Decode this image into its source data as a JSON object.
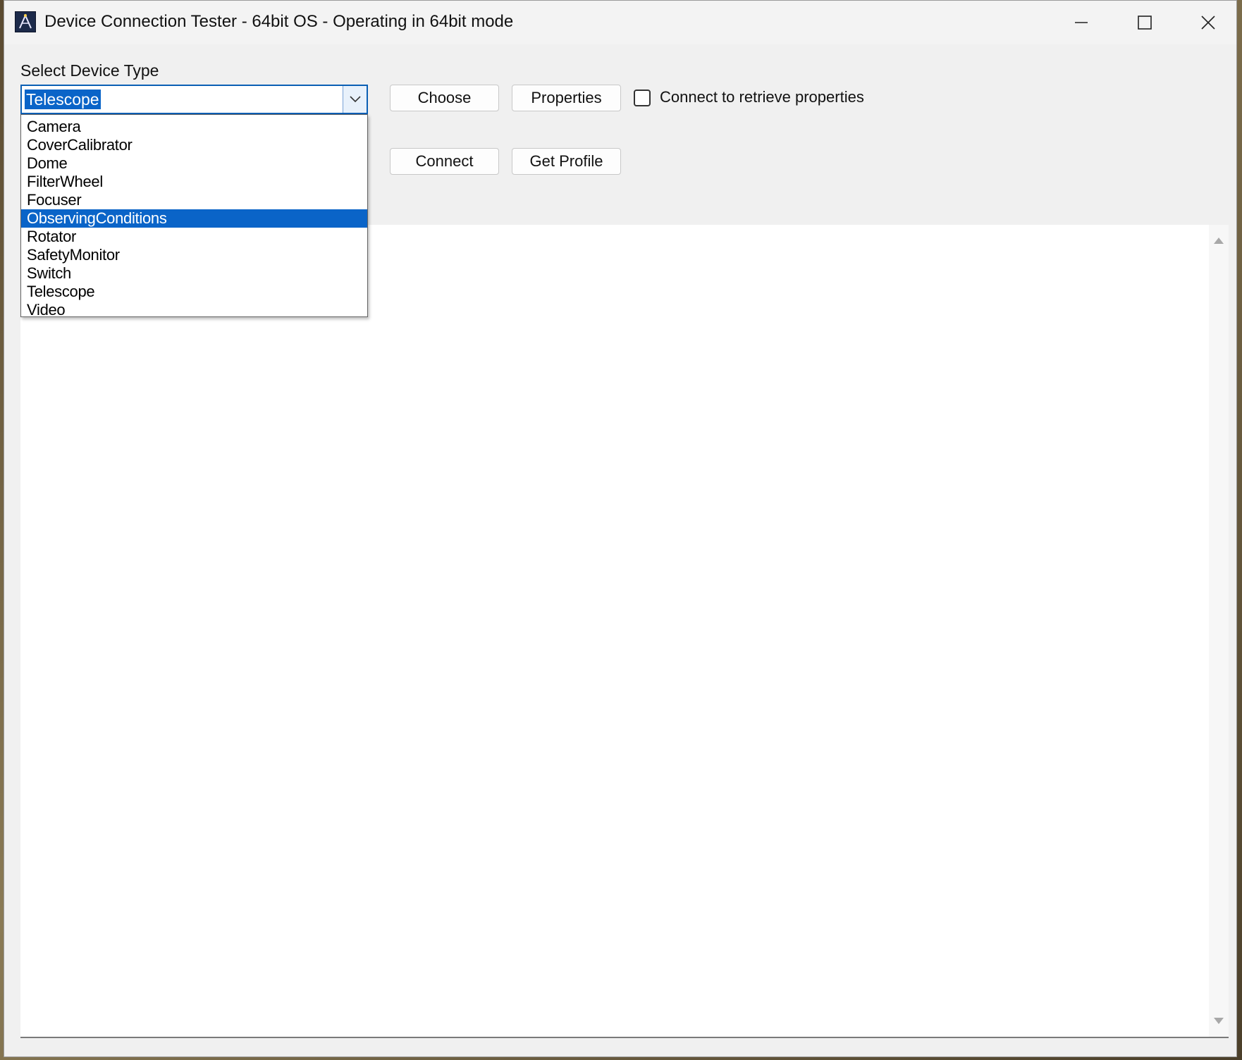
{
  "window": {
    "title": "Device Connection Tester - 64bit OS - Operating in 64bit mode"
  },
  "device_select": {
    "label": "Select Device Type",
    "selected_value": "Telescope",
    "options": [
      {
        "label": "Camera"
      },
      {
        "label": "CoverCalibrator"
      },
      {
        "label": "Dome"
      },
      {
        "label": "FilterWheel"
      },
      {
        "label": "Focuser"
      },
      {
        "label": "ObservingConditions",
        "highlighted": true
      },
      {
        "label": "Rotator"
      },
      {
        "label": "SafetyMonitor"
      },
      {
        "label": "Switch"
      },
      {
        "label": "Telescope"
      },
      {
        "label": "Video"
      }
    ]
  },
  "buttons": {
    "choose": "Choose",
    "properties": "Properties",
    "connect": "Connect",
    "get_profile": "Get Profile"
  },
  "options": {
    "connect_to_retrieve": "Connect to retrieve properties",
    "connect_to_retrieve_checked": false
  },
  "output": {
    "text": ""
  },
  "colors": {
    "selection": "#0a64c8",
    "window_bg": "#f0f0f0",
    "focus_border": "#0a5fb4"
  },
  "icons": [
    "app-icon",
    "minimize-icon",
    "maximize-icon",
    "close-icon",
    "chevron-down-icon",
    "scroll-up-icon",
    "scroll-down-icon"
  ]
}
